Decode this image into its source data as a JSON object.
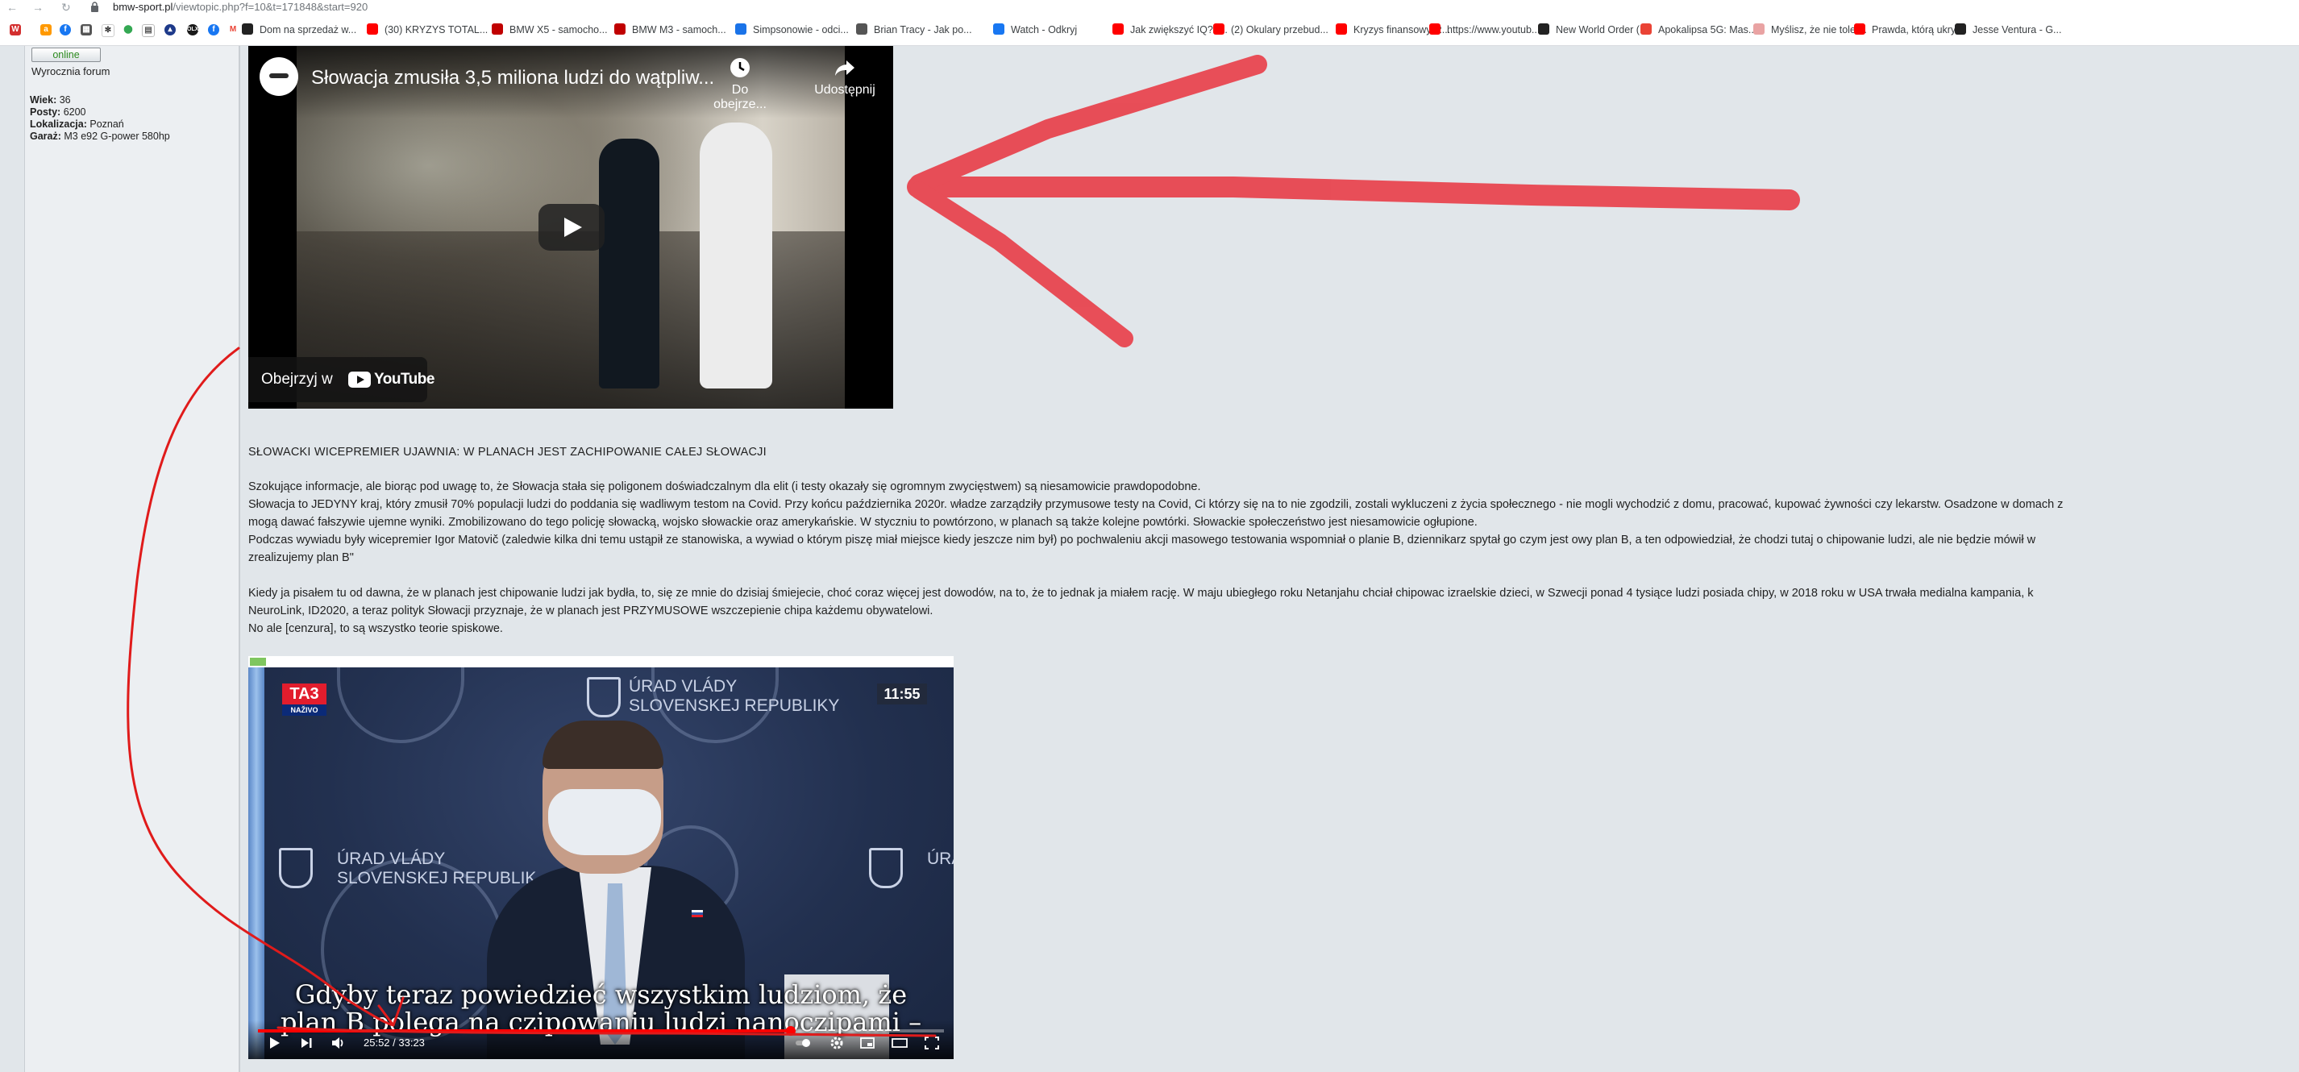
{
  "browser": {
    "url_host": "bmw-sport.pl",
    "url_path": "/viewtopic.php?f=10&t=171848&start=920",
    "bookmarks": [
      {
        "label": "Dom na sprzedaż w...",
        "icon": "page-icon",
        "color": "#222222"
      },
      {
        "label": "(30) KRYZYS TOTAL...",
        "icon": "youtube-icon",
        "color": "#ff0000"
      },
      {
        "label": "BMW X5 - samocho...",
        "icon": "otomoto-icon",
        "color": "#c00000"
      },
      {
        "label": "BMW M3 - samoch...",
        "icon": "otomoto-icon",
        "color": "#c00000"
      },
      {
        "label": "Simpsonowie - odci...",
        "icon": "tv-icon",
        "color": "#1a73e8"
      },
      {
        "label": "Brian Tracy - Jak po...",
        "icon": "globe-icon",
        "color": "#555555"
      },
      {
        "label": "Watch - Odkryj",
        "icon": "facebook-icon",
        "color": "#1877f2"
      },
      {
        "label": "Jak zwiększyć IQ? -...",
        "icon": "youtube-icon",
        "color": "#ff0000"
      },
      {
        "label": "(2) Okulary przebud...",
        "icon": "youtube-icon",
        "color": "#ff0000"
      },
      {
        "label": "Kryzys finansowy-R...",
        "icon": "youtube-icon",
        "color": "#ff0000"
      },
      {
        "label": "https://www.youtub...",
        "icon": "youtube-icon",
        "color": "#ff0000"
      },
      {
        "label": "New World Order (...",
        "icon": "dailymotion-icon",
        "color": "#222222"
      },
      {
        "label": "Apokalipsa 5G: Mas...",
        "icon": "google-icon",
        "color": "#ea4335"
      },
      {
        "label": "Myślisz, że nie toler...",
        "icon": "page-icon",
        "color": "#e9a3a3"
      },
      {
        "label": "Prawda, którą ukry...",
        "icon": "youtube-icon",
        "color": "#ff0000"
      },
      {
        "label": "Jesse Ventura - G...",
        "icon": "dailymotion-icon",
        "color": "#222222"
      }
    ]
  },
  "profile": {
    "status": "online",
    "rank": "Wyrocznia forum",
    "stats": [
      {
        "label": "Wiek:",
        "value": "36"
      },
      {
        "label": "Posty:",
        "value": "6200"
      },
      {
        "label": "Lokalizacja:",
        "value": "Poznań"
      },
      {
        "label": "Garaż:",
        "value": "M3 e92 G-power 580hp"
      }
    ]
  },
  "video1": {
    "title": "Słowacja zmusiła 3,5 miliona ludzi do wątpliw...",
    "watch_later": "Do obejrze...",
    "share": "Udostępnij",
    "watch_on": "Obejrzyj w",
    "yt_word": "YouTube"
  },
  "post": {
    "headline": "SŁOWACKI WICEPREMIER UJAWNIA: W PLANACH JEST ZACHIPOWANIE CAŁEJ SŁOWACJI",
    "para1": [
      "Szokujące informacje, ale biorąc pod uwagę to, że Słowacja stała się poligonem doświadczalnym dla elit (i testy okazały się ogromnym zwycięstwem) są niesamowicie prawdopodobne.",
      "Słowacja to JEDYNY kraj, który zmusił 70% populacji ludzi do poddania się wadliwym testom na Covid. Przy końcu października 2020r. władze zarządziły przymusowe testy na Covid, Ci którzy się na to nie zgodzili, zostali wykluczeni z życia społecznego - nie mogli wychodzić z domu, pracować, kupować żywności czy lekarstw. Osadzone w domach z",
      "mogą dawać fałszywie ujemne wyniki. Zmobilizowano do tego policję słowacką, wojsko słowackie oraz amerykańskie. W styczniu to powtórzono, w planach są także kolejne powtórki. Słowackie społeczeństwo jest niesamowicie ogłupione.",
      "Podczas wywiadu były wicepremier Igor Matovič (zaledwie kilka dni temu ustąpił ze stanowiska, a wywiad o którym piszę miał miejsce kiedy jeszcze nim był) po pochwaleniu akcji masowego testowania wspomniał o planie B, dziennikarz spytał go czym jest owy plan B, a ten odpowiedział, że chodzi tutaj o chipowanie ludzi, ale nie będzie mówił w",
      "zrealizujemy plan B\""
    ],
    "para2": [
      "Kiedy ja pisałem tu od dawna, że w planach jest chipowanie ludzi jak bydła, to, się ze mnie do dzisiaj śmiejecie, choć coraz więcej jest dowodów, na to, że to jednak ja miałem rację. W maju ubiegłego roku Netanjahu chciał chipowac izraelskie dzieci, w Szwecji ponad 4 tysiące ludzi posiada chipy, w 2018 roku w USA trwała medialna kampania, k",
      "NeuroLink, ID2020, a teraz polityk Słowacji przyznaje, że w planach jest PRZYMUSOWE wszczepienie chipa każdemu obywatelowi.",
      "No ale [cenzura], to są wszystko teorie spiskowe."
    ]
  },
  "video2": {
    "channel": "TA3",
    "live": "NAŽIVO",
    "clock": "11:55",
    "office_line1": "ÚRAD VLÁDY",
    "office_line2": "SLOVENSKEJ REPUBLIKY",
    "office_left_line1": "ÚRAD VLÁDY",
    "office_left_line2": "SLOVENSKEJ REPUBLIK",
    "office_right": "ÚRA",
    "subtitle_line1": "Gdyby teraz powiedzieć wszystkim ludziom, że",
    "subtitle_line2": "plan B polega na czipowaniu ludzi nanoczipami –",
    "time": "25:52 / 33:23",
    "progress": 0.777
  }
}
